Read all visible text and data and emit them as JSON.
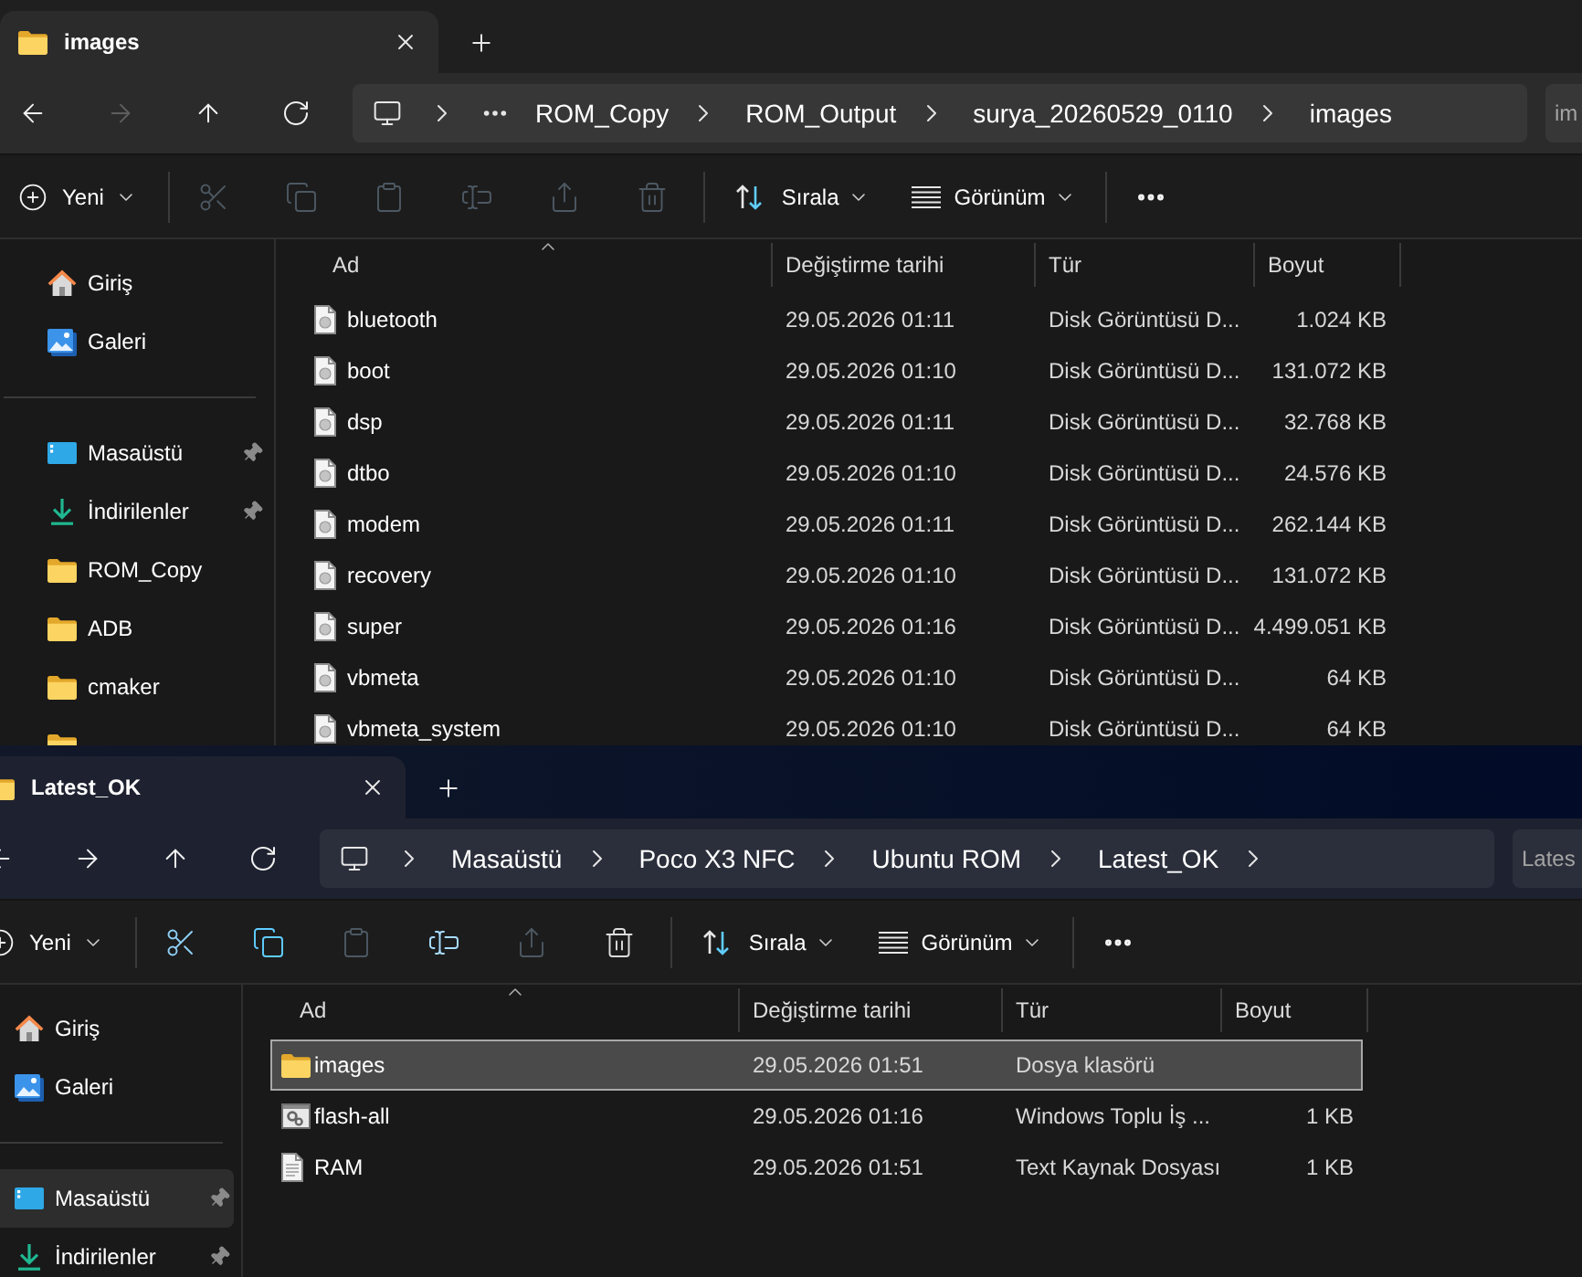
{
  "windows": [
    {
      "focused": false,
      "tab": {
        "title": "images"
      },
      "navigation": [
        {
          "kind": "back",
          "disabled": false
        },
        {
          "kind": "forward",
          "disabled": true
        },
        {
          "kind": "up",
          "disabled": false
        },
        {
          "kind": "refresh",
          "disabled": false
        }
      ],
      "address": {
        "hidden_crumbs": true,
        "crumbs": [
          "ROM_Copy",
          "ROM_Output",
          "surya_20260529_0110",
          "images"
        ],
        "trailing_chevron": false
      },
      "search": {
        "placeholder": "im"
      },
      "toolbar": {
        "new": "Yeni",
        "actions": [
          {
            "kind": "cut",
            "disabled": true
          },
          {
            "kind": "copy",
            "disabled": true
          },
          {
            "kind": "paste",
            "disabled": true
          },
          {
            "kind": "rename",
            "disabled": true
          },
          {
            "kind": "share",
            "disabled": true
          },
          {
            "kind": "delete",
            "disabled": true
          }
        ],
        "sort": "Sırala",
        "view": "Görünüm"
      },
      "sidebar": {
        "sections": [
          {
            "items": [
              {
                "kind": "home",
                "label": "Giriş",
                "pinned": false,
                "selected": false
              },
              {
                "kind": "gallery",
                "label": "Galeri",
                "pinned": false,
                "selected": false
              }
            ]
          },
          {
            "items": [
              {
                "kind": "desktop",
                "label": "Masaüstü",
                "pinned": true,
                "selected": false
              },
              {
                "kind": "downloads",
                "label": "İndirilenler",
                "pinned": true,
                "selected": false
              },
              {
                "kind": "folder",
                "label": "ROM_Copy",
                "pinned": false,
                "selected": false
              },
              {
                "kind": "folder",
                "label": "ADB",
                "pinned": false,
                "selected": false
              },
              {
                "kind": "folder",
                "label": "cmaker",
                "pinned": false,
                "selected": false
              },
              {
                "kind": "folder",
                "pinned": false,
                "selected": false
              }
            ]
          }
        ]
      },
      "columns": [
        {
          "label": "Ad",
          "sorted": true
        },
        {
          "label": "Değiştirme tarihi",
          "sorted": false
        },
        {
          "label": "Tür",
          "sorted": false
        },
        {
          "label": "Boyut",
          "sorted": false
        }
      ],
      "rows": [
        {
          "kind": "disk_image",
          "name": "bluetooth",
          "modified": "29.05.2026 01:11",
          "type": "Disk Görüntüsü D...",
          "size": "1.024 KB",
          "selected": false
        },
        {
          "kind": "disk_image",
          "name": "boot",
          "modified": "29.05.2026 01:10",
          "type": "Disk Görüntüsü D...",
          "size": "131.072 KB",
          "selected": false
        },
        {
          "kind": "disk_image",
          "name": "dsp",
          "modified": "29.05.2026 01:11",
          "type": "Disk Görüntüsü D...",
          "size": "32.768 KB",
          "selected": false
        },
        {
          "kind": "disk_image",
          "name": "dtbo",
          "modified": "29.05.2026 01:10",
          "type": "Disk Görüntüsü D...",
          "size": "24.576 KB",
          "selected": false
        },
        {
          "kind": "disk_image",
          "name": "modem",
          "modified": "29.05.2026 01:11",
          "type": "Disk Görüntüsü D...",
          "size": "262.144 KB",
          "selected": false
        },
        {
          "kind": "disk_image",
          "name": "recovery",
          "modified": "29.05.2026 01:10",
          "type": "Disk Görüntüsü D...",
          "size": "131.072 KB",
          "selected": false
        },
        {
          "kind": "disk_image",
          "name": "super",
          "modified": "29.05.2026 01:16",
          "type": "Disk Görüntüsü D...",
          "size": "4.499.051 KB",
          "selected": false
        },
        {
          "kind": "disk_image",
          "name": "vbmeta",
          "modified": "29.05.2026 01:10",
          "type": "Disk Görüntüsü D...",
          "size": "64 KB",
          "selected": false
        },
        {
          "kind": "disk_image",
          "name": "vbmeta_system",
          "modified": "29.05.2026 01:10",
          "type": "Disk Görüntüsü D...",
          "size": "64 KB",
          "selected": false
        }
      ]
    },
    {
      "focused": true,
      "tab": {
        "title": "Latest_OK"
      },
      "navigation": [
        {
          "kind": "back",
          "disabled": false
        },
        {
          "kind": "forward",
          "disabled": false
        },
        {
          "kind": "up",
          "disabled": false
        },
        {
          "kind": "refresh",
          "disabled": false
        }
      ],
      "address": {
        "hidden_crumbs": false,
        "crumbs": [
          "Masaüstü",
          "Poco X3 NFC",
          "Ubuntu ROM",
          "Latest_OK"
        ],
        "trailing_chevron": true
      },
      "search": {
        "placeholder": "Lates"
      },
      "toolbar": {
        "new": "Yeni",
        "actions": [
          {
            "kind": "cut",
            "disabled": false
          },
          {
            "kind": "copy",
            "disabled": false
          },
          {
            "kind": "paste",
            "disabled": true
          },
          {
            "kind": "rename",
            "disabled": false
          },
          {
            "kind": "share",
            "disabled": true
          },
          {
            "kind": "delete",
            "disabled": false
          }
        ],
        "sort": "Sırala",
        "view": "Görünüm"
      },
      "sidebar": {
        "sections": [
          {
            "items": [
              {
                "kind": "home",
                "label": "Giriş",
                "pinned": false,
                "selected": false
              },
              {
                "kind": "gallery",
                "label": "Galeri",
                "pinned": false,
                "selected": false
              }
            ]
          },
          {
            "items": [
              {
                "kind": "desktop",
                "label": "Masaüstü",
                "pinned": true,
                "selected": true
              },
              {
                "kind": "downloads",
                "label": "İndirilenler",
                "pinned": true,
                "selected": false
              }
            ]
          }
        ]
      },
      "columns": [
        {
          "label": "Ad",
          "sorted": true
        },
        {
          "label": "Değiştirme tarihi",
          "sorted": false
        },
        {
          "label": "Tür",
          "sorted": false
        },
        {
          "label": "Boyut",
          "sorted": false
        }
      ],
      "rows": [
        {
          "kind": "folder",
          "name": "images",
          "modified": "29.05.2026 01:51",
          "type": "Dosya klasörü",
          "selected": true
        },
        {
          "kind": "batch",
          "name": "flash-all",
          "modified": "29.05.2026 01:16",
          "type": "Windows Toplu İş ...",
          "size": "1 KB",
          "selected": false
        },
        {
          "kind": "text",
          "name": "RAM",
          "modified": "29.05.2026 01:51",
          "type": "Text Kaynak Dosyası",
          "size": "1 KB",
          "selected": false
        }
      ]
    }
  ]
}
